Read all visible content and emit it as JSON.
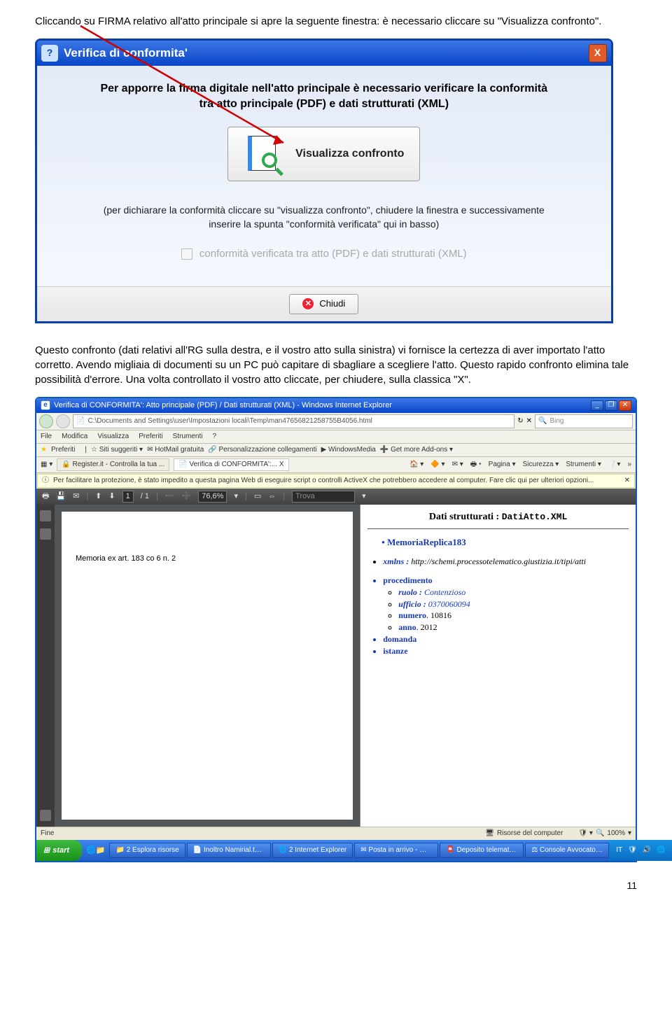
{
  "intro": {
    "p1a": "Cliccando su FIRMA relativo all'atto principale si apre la seguente finestra: è necessario cliccare su ",
    "p1b": "\"Visualizza confronto\"."
  },
  "dialog": {
    "title": "Verifica di conformita'",
    "close_x": "X",
    "heading_l1": "Per apporre la firma digitale nell'atto principale è necessario verificare la conformità",
    "heading_l2": "tra atto principale (PDF) e dati strutturati (XML)",
    "vc_label": "Visualizza confronto",
    "sub_l1": "(per dichiarare la conformità cliccare su \"visualizza confronto\", chiudere la finestra e successivamente",
    "sub_l2": "inserire la spunta \"conformità verificata\" qui in basso)",
    "checkbox_label": "conformità verificata tra atto (PDF) e dati strutturati (XML)",
    "chiudi": "Chiudi"
  },
  "mid": {
    "p1": "Questo confronto (dati relativi all'RG sulla destra, e il vostro atto sulla sinistra) vi fornisce la certezza di aver importato l'atto corretto. Avendo migliaia di documenti su un PC può capitare di sbagliare a scegliere l'atto. Questo rapido confronto elimina tale possibilità d'errore. Una volta controllato il vostro atto cliccate, per chiudere, sulla classica \"X\"."
  },
  "ie": {
    "title": "Verifica di CONFORMITA': Atto principale (PDF) / Dati strutturati (XML) - Windows Internet Explorer",
    "address": "C:\\Documents and Settings\\user\\Impostazioni locali\\Temp\\man47656821258755B4056.html",
    "search_engine": "Bing",
    "menu": [
      "File",
      "Modifica",
      "Visualizza",
      "Preferiti",
      "Strumenti",
      "?"
    ],
    "fav": {
      "preferiti": "Preferiti",
      "items": [
        "Siti suggeriti",
        "HotMail gratuita",
        "Personalizzazione collegamenti",
        "WindowsMedia",
        "Get more Add-ons"
      ]
    },
    "tabs": {
      "t1": "Register.it - Controlla la tua ...",
      "t2": "Verifica di CONFORMITA':... X"
    },
    "right_tools": [
      "Pagina",
      "Sicurezza",
      "Strumenti"
    ],
    "infobar": "Per facilitare la protezione, è stato impedito a questa pagina Web di eseguire script o controlli ActiveX che potrebbero accedere al computer. Fare clic qui per ulteriori opzioni...",
    "pdf": {
      "page": "1",
      "pages": "/ 1",
      "zoom": "76,6%",
      "trova": "Trova"
    },
    "doc_title": "Memoria ex art. 183 co 6 n. 2",
    "xml": {
      "header_label": "Dati strutturati : ",
      "header_file": "DatiAtto.XML",
      "memoria": "MemoriaReplica183",
      "xmlns_label": "xmlns : ",
      "xmlns_val": "http://schemi.processotelematico.giustizia.it/tipi/atti",
      "proc": "procedimento",
      "ruolo_label": "ruolo : ",
      "ruolo_val": "Contenzioso",
      "ufficio_label": "ufficio : ",
      "ufficio_val": "0370060094",
      "numero_label": "numero",
      "numero_val": ". 10816",
      "anno_label": "anno",
      "anno_val": ". 2012",
      "domanda": "domanda",
      "istanze": "istanze"
    },
    "status": {
      "fine": "Fine",
      "risorse": "Risorse del computer",
      "zoom": "100%"
    }
  },
  "taskbar": {
    "start": "start",
    "items": [
      "2 Esplora risorse",
      "Inoltro Namirial.txt -...",
      "2 Internet Explorer",
      "Posta in arrivo - Micr...",
      "Deposito telematic...",
      "Console Avvocato®..."
    ],
    "lang": "IT"
  },
  "page_number": "11"
}
